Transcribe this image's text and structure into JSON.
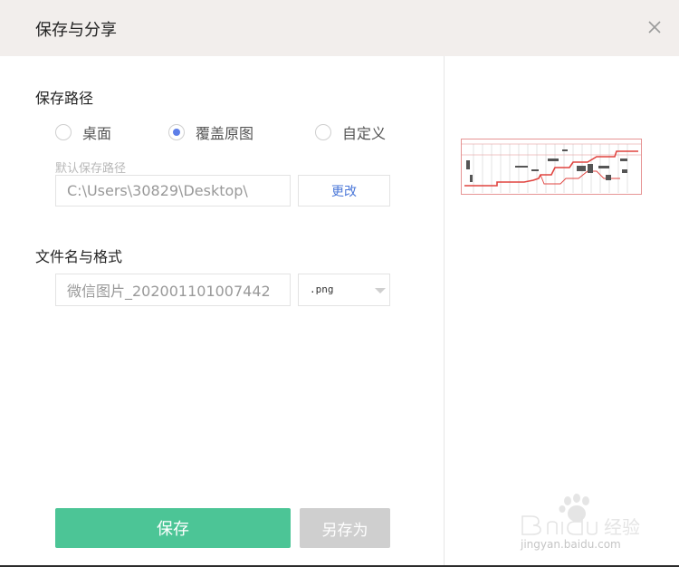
{
  "dialog": {
    "title": "保存与分享",
    "close_icon": "close-icon"
  },
  "save_path": {
    "section_label": "保存路径",
    "options": [
      {
        "label": "桌面",
        "checked": false
      },
      {
        "label": "覆盖原图",
        "checked": true
      },
      {
        "label": "自定义",
        "checked": false
      }
    ],
    "hint": "默认保存路径",
    "path_value": "C:\\Users\\30829\\Desktop\\",
    "change_button": "更改"
  },
  "file": {
    "section_label": "文件名与格式",
    "name_value": "微信图片_202001101007442",
    "format_selected": ".png"
  },
  "actions": {
    "save": "保存",
    "save_as": "另存为"
  },
  "watermark": {
    "brand": "Bai",
    "brand_suffix": "du",
    "cn": "经验",
    "url": "jingyan.baidu.com"
  },
  "colors": {
    "accent_green": "#4cc596",
    "radio_blue": "#5d7ee8",
    "link_blue": "#4a77d8",
    "titlebar_bg": "#f2eeec",
    "disabled_gray": "#cfcfcf"
  }
}
